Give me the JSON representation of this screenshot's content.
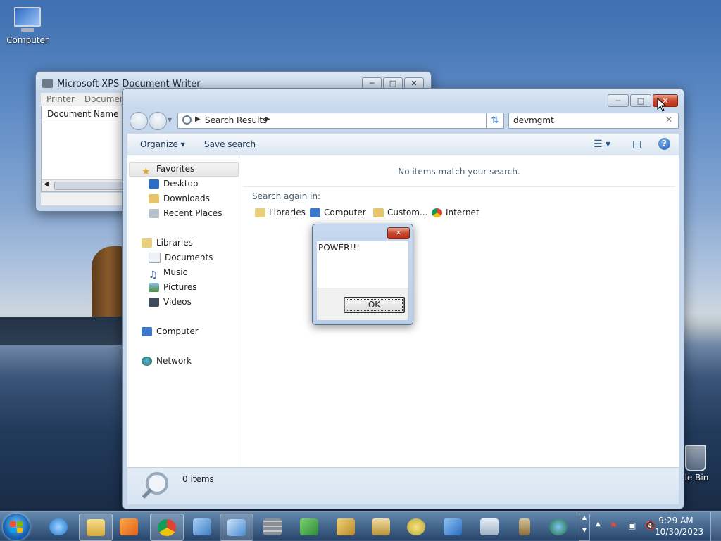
{
  "desktop": {
    "icons": [
      {
        "label": "Computer",
        "icon": "computer-icon"
      },
      {
        "label": "cle Bin",
        "icon": "recycle-bin-icon"
      }
    ]
  },
  "xps_window": {
    "title": "Microsoft XPS Document Writer",
    "menu": [
      "Printer",
      "Document"
    ],
    "column_header": "Document Name"
  },
  "explorer": {
    "address": {
      "crumb": "Search Results"
    },
    "search": {
      "query": "devmgmt"
    },
    "toolbar": {
      "organize": "Organize",
      "save_search": "Save search"
    },
    "nav": {
      "favorites": "Favorites",
      "favorites_items": [
        "Desktop",
        "Downloads",
        "Recent Places"
      ],
      "libraries": "Libraries",
      "libraries_items": [
        "Documents",
        "Music",
        "Pictures",
        "Videos"
      ],
      "computer": "Computer",
      "network": "Network"
    },
    "content": {
      "no_items": "No items match your search.",
      "search_again": "Search again in:",
      "locations": [
        "Libraries",
        "Computer",
        "Custom...",
        "Internet"
      ]
    },
    "details": {
      "count": "0 items"
    }
  },
  "message_box": {
    "text": "POWER!!!",
    "ok": "OK"
  },
  "taskbar": {
    "time": "9:29 AM",
    "date": "10/30/2023",
    "accent": "#1863b2"
  }
}
